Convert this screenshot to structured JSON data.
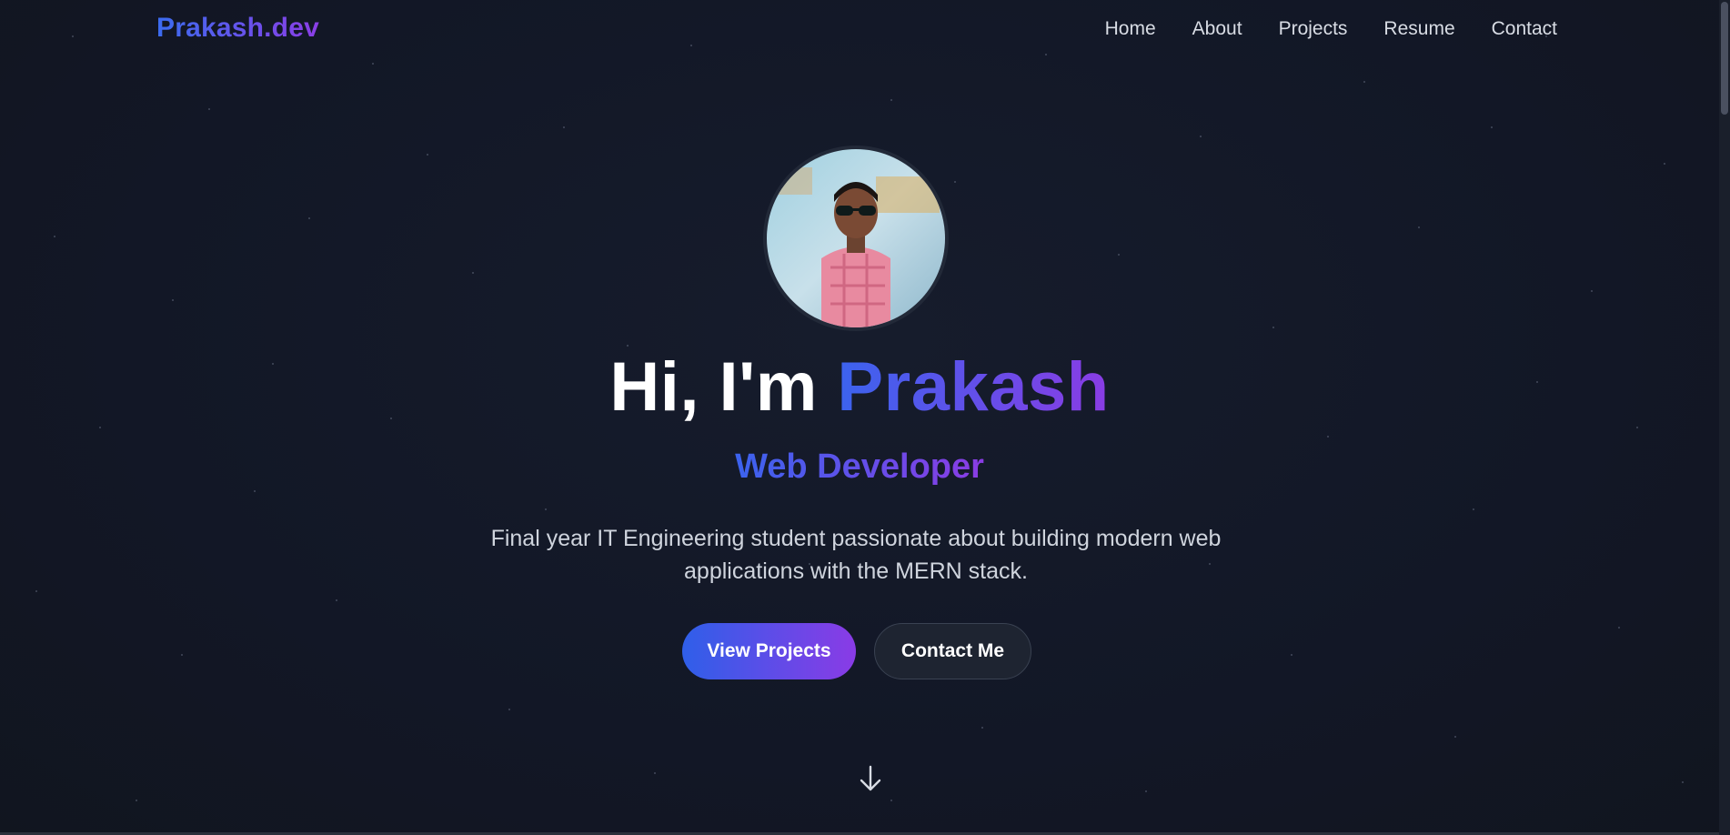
{
  "navbar": {
    "logo": "Prakash.dev",
    "links": [
      "Home",
      "About",
      "Projects",
      "Resume",
      "Contact"
    ]
  },
  "hero": {
    "greeting": "Hi, I'm ",
    "name": "Prakash",
    "role": "Web Developer",
    "description": "Final year IT Engineering student passionate about building modern web applications with the MERN stack.",
    "primary_button": "View Projects",
    "secondary_button": "Contact Me",
    "avatar_icon": "profile-photo",
    "scroll_icon": "arrow-down-icon"
  },
  "colors": {
    "background": "#131827",
    "accent_start": "#3b63ee",
    "accent_end": "#8a3ce4",
    "text": "#ffffff",
    "muted": "#cfd4dd"
  }
}
